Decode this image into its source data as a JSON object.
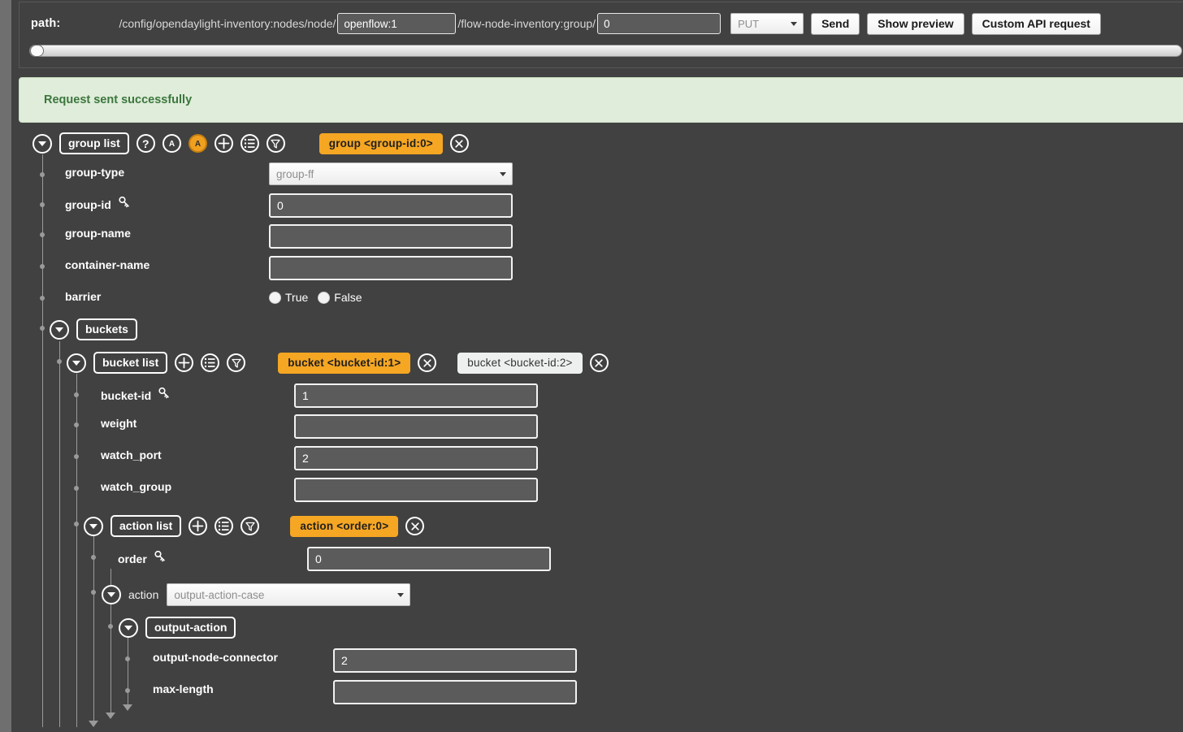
{
  "pathbar": {
    "label": "path:",
    "prefix": "/config/opendaylight-inventory:nodes/node/",
    "node_value": "openflow:1",
    "middle": "/flow-node-inventory:group/",
    "group_value": "0",
    "method": "PUT",
    "send_label": "Send",
    "preview_label": "Show preview",
    "custom_label": "Custom API request"
  },
  "banner": {
    "text": "Request sent successfully"
  },
  "group_list": {
    "tag": "group list",
    "icons": [
      "help-icon",
      "augment-outline-icon",
      "augment-filled-icon",
      "add-icon",
      "list-icon",
      "filter-icon"
    ],
    "badge": "group  <group-id:0>"
  },
  "group_fields": {
    "group_type": {
      "label": "group-type",
      "value": "group-ff"
    },
    "group_id": {
      "label": "group-id",
      "value": "0"
    },
    "group_name": {
      "label": "group-name",
      "value": ""
    },
    "container_name": {
      "label": "container-name",
      "value": ""
    },
    "barrier": {
      "label": "barrier",
      "true_label": "True",
      "false_label": "False"
    }
  },
  "buckets": {
    "tag": "buckets"
  },
  "bucket_list": {
    "tag": "bucket list",
    "badge_active": "bucket  <bucket-id:1>",
    "badge_inactive": "bucket  <bucket-id:2>"
  },
  "bucket_fields": {
    "bucket_id": {
      "label": "bucket-id",
      "value": "1"
    },
    "weight": {
      "label": "weight",
      "value": ""
    },
    "watch_port": {
      "label": "watch_port",
      "value": "2"
    },
    "watch_group": {
      "label": "watch_group",
      "value": ""
    }
  },
  "action_list": {
    "tag": "action list",
    "badge": "action  <order:0>",
    "order": {
      "label": "order",
      "value": "0"
    },
    "action": {
      "label": "action",
      "value": "output-action-case"
    }
  },
  "output_action": {
    "tag": "output-action",
    "output_node_connector": {
      "label": "output-node-connector",
      "value": "2"
    },
    "max_length": {
      "label": "max-length",
      "value": ""
    }
  },
  "colors": {
    "background": "#414141",
    "accent_orange": "#f5a623",
    "success_bg": "#dfedda",
    "success_text": "#3c763d"
  }
}
